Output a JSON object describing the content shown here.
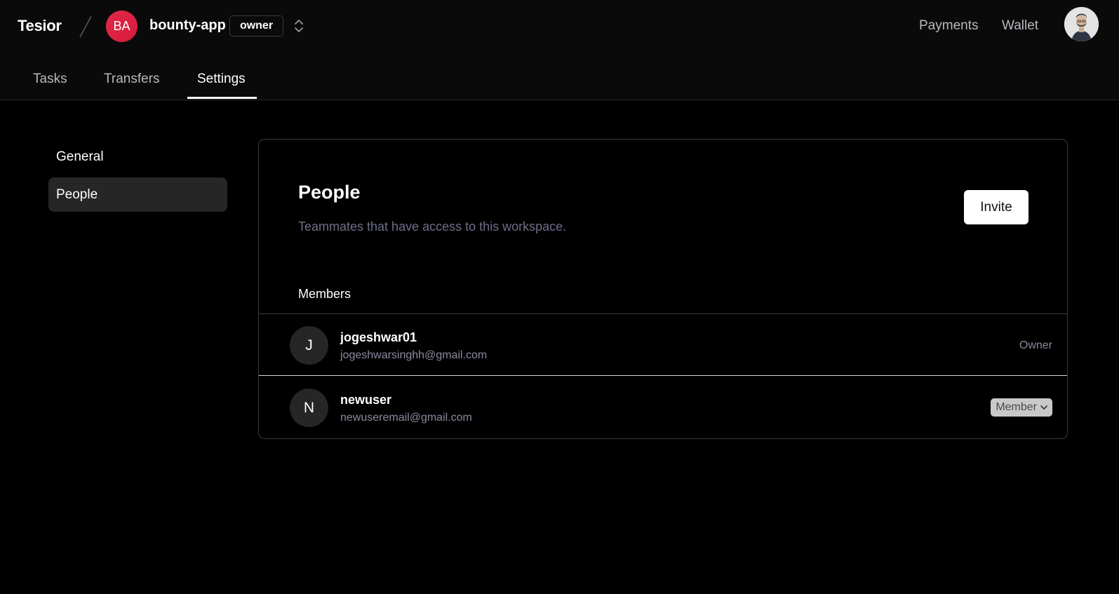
{
  "header": {
    "brand": "Tesior",
    "workspace": {
      "initials": "BA",
      "name": "bounty-app",
      "role": "owner"
    },
    "nav": {
      "payments": "Payments",
      "wallet": "Wallet"
    },
    "icons": {
      "switcher": "chevrons-up-down-icon",
      "avatar": "user-avatar-icon"
    }
  },
  "tabs": [
    {
      "label": "Tasks",
      "active": false
    },
    {
      "label": "Transfers",
      "active": false
    },
    {
      "label": "Settings",
      "active": true
    }
  ],
  "sidebar": {
    "items": [
      {
        "label": "General",
        "active": false
      },
      {
        "label": "People",
        "active": true
      }
    ]
  },
  "people": {
    "title": "People",
    "subtitle": "Teammates that have access to this workspace.",
    "invite_label": "Invite",
    "members_heading": "Members",
    "members": [
      {
        "initial": "J",
        "name": "jogeshwar01",
        "email": "jogeshwarsinghh@gmail.com",
        "role": "Owner"
      },
      {
        "initial": "N",
        "name": "newuser",
        "email": "newuseremail@gmail.com",
        "role": "Member"
      }
    ]
  },
  "colors": {
    "background": "#000000",
    "header_bg": "#0a0a0a",
    "workspace_avatar": "#e0294a",
    "muted_text": "#6e6e8a",
    "active_sidebar": "#262626"
  }
}
